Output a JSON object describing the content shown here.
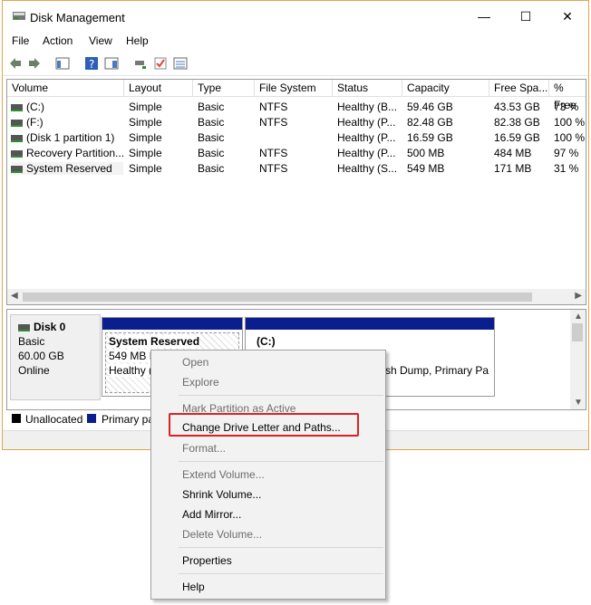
{
  "window": {
    "title": "Disk Management",
    "minimize": "—",
    "maximize": "☐",
    "close": "✕"
  },
  "menu": [
    "File",
    "Action",
    "View",
    "Help"
  ],
  "columns": [
    "Volume",
    "Layout",
    "Type",
    "File System",
    "Status",
    "Capacity",
    "Free Spa...",
    "% Free"
  ],
  "volumes": [
    {
      "volume": "(C:)",
      "layout": "Simple",
      "type": "Basic",
      "fs": "NTFS",
      "status": "Healthy (B...",
      "capacity": "59.46 GB",
      "free": "43.53 GB",
      "pct": "73 %"
    },
    {
      "volume": "(F:)",
      "layout": "Simple",
      "type": "Basic",
      "fs": "NTFS",
      "status": "Healthy (P...",
      "capacity": "82.48 GB",
      "free": "82.38 GB",
      "pct": "100 %"
    },
    {
      "volume": "(Disk 1 partition 1)",
      "layout": "Simple",
      "type": "Basic",
      "fs": "",
      "status": "Healthy (P...",
      "capacity": "16.59 GB",
      "free": "16.59 GB",
      "pct": "100 %"
    },
    {
      "volume": "Recovery Partition...",
      "layout": "Simple",
      "type": "Basic",
      "fs": "NTFS",
      "status": "Healthy (P...",
      "capacity": "500 MB",
      "free": "484 MB",
      "pct": "97 %"
    },
    {
      "volume": "System Reserved",
      "layout": "Simple",
      "type": "Basic",
      "fs": "NTFS",
      "status": "Healthy (S...",
      "capacity": "549 MB",
      "free": "171 MB",
      "pct": "31 %"
    }
  ],
  "disk": {
    "name": "Disk 0",
    "type": "Basic",
    "size": "60.00 GB",
    "state": "Online"
  },
  "partitions": {
    "sysres": {
      "name": "System Reserved",
      "line2": "549 MB N",
      "line3": "Healthy ("
    },
    "c": {
      "name": "(C:)",
      "line3": "sh Dump, Primary Pa"
    }
  },
  "legend": {
    "unallocated": "Unallocated",
    "primary": "Primary pa"
  },
  "context_menu": {
    "open": "Open",
    "explore": "Explore",
    "mark_active": "Mark Partition as Active",
    "change_letter": "Change Drive Letter and Paths...",
    "format": "Format...",
    "extend": "Extend Volume...",
    "shrink": "Shrink Volume...",
    "add_mirror": "Add Mirror...",
    "delete": "Delete Volume...",
    "properties": "Properties",
    "help": "Help"
  },
  "colors": {
    "primary_partition": "#0b1e8d",
    "highlight_box": "#e02020",
    "window_border": "#e0a64b"
  }
}
